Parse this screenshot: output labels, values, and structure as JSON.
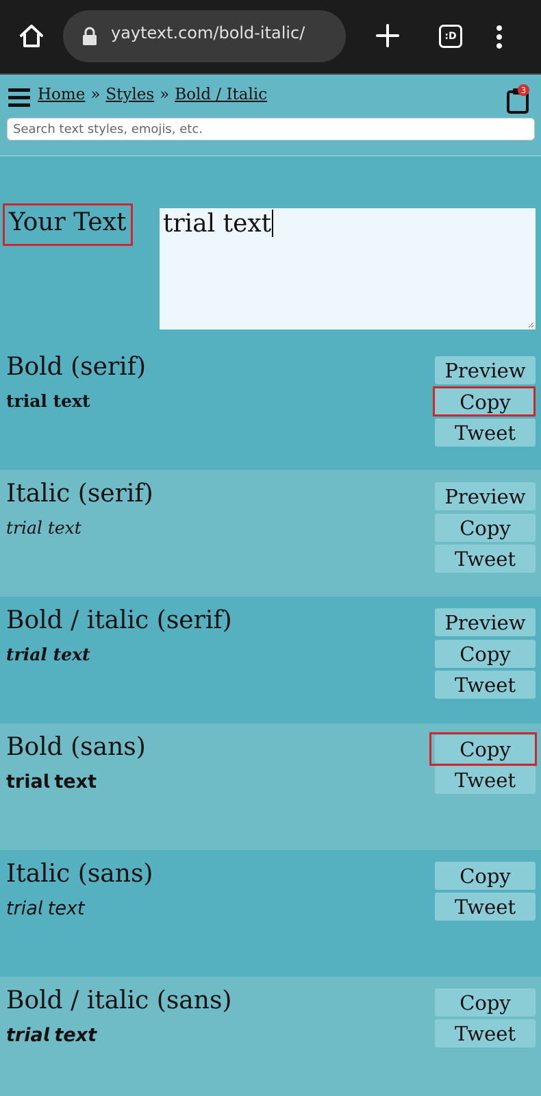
{
  "browser": {
    "url": "yaytext.com/bold-italic/",
    "tabs_label": ":D"
  },
  "breadcrumb": {
    "home": "Home",
    "styles": "Styles",
    "current": "Bold / Italic",
    "separator": "»"
  },
  "cart": {
    "badge": "3"
  },
  "search": {
    "placeholder": "Search text styles, emojis, etc.",
    "value": ""
  },
  "input": {
    "label": "Your Text",
    "value": "trial text"
  },
  "sections": [
    {
      "title": "Bold (serif)",
      "sample": "𝐭𝐫𝐢𝐚𝐥 𝐭𝐞𝐱𝐭",
      "preview": "Preview",
      "copy": "Copy",
      "tweet": "Tweet"
    },
    {
      "title": "Italic (serif)",
      "sample": "𝑡𝑟𝑖𝑎𝑙 𝑡𝑒𝑥𝑡",
      "preview": "Preview",
      "copy": "Copy",
      "tweet": "Tweet"
    },
    {
      "title": "Bold / italic (serif)",
      "sample": "𝒕𝒓𝒊𝒂𝒍 𝒕𝒆𝒙𝒕",
      "preview": "Preview",
      "copy": "Copy",
      "tweet": "Tweet"
    },
    {
      "title": "Bold (sans)",
      "sample": "𝘁𝗿𝗶𝗮𝗹 𝘁𝗲𝘅𝘁",
      "copy": "Copy",
      "tweet": "Tweet"
    },
    {
      "title": "Italic (sans)",
      "sample": "𝘵𝘳𝘪𝘢𝘭 𝘵𝘦𝘹𝘵",
      "copy": "Copy",
      "tweet": "Tweet"
    },
    {
      "title": "Bold / italic (sans)",
      "sample": "𝙩𝙧𝙞𝙖𝙡 𝙩𝙚𝙭𝙩",
      "copy": "Copy",
      "tweet": "Tweet"
    }
  ],
  "colors": {
    "highlight": "#d0262d",
    "section_dark": "#55b0c0",
    "section_light": "#6fbcc7",
    "button": "#8acdd7"
  }
}
